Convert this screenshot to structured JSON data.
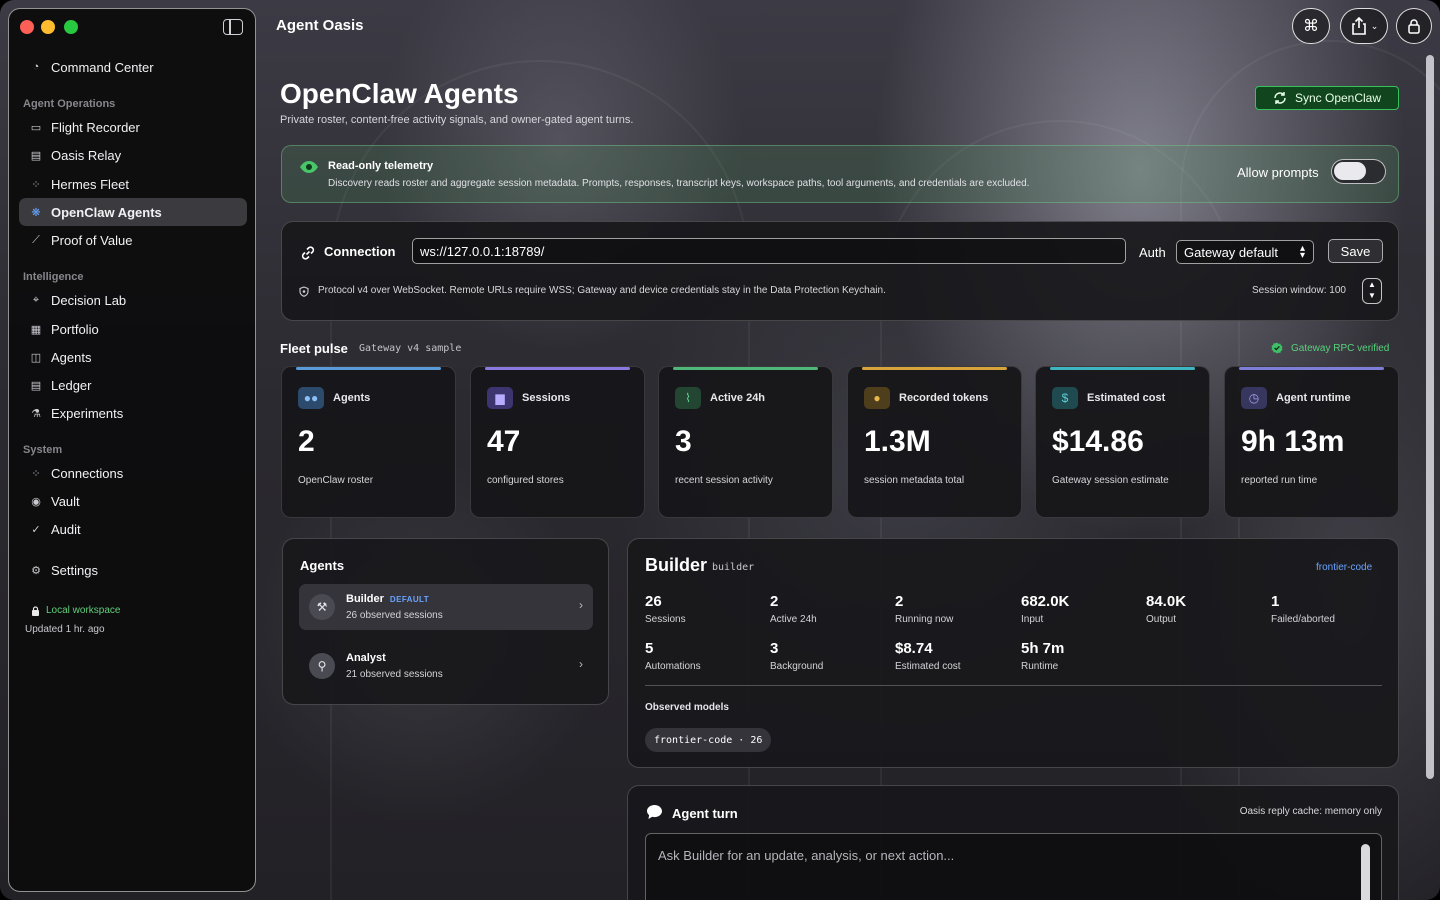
{
  "app": {
    "title": "Agent Oasis"
  },
  "sidebar": {
    "top_item": {
      "label": "Command Center",
      "icon": "gauge-icon"
    },
    "sections": [
      {
        "label": "Agent Operations"
      },
      {
        "label": "Intelligence"
      },
      {
        "label": "System"
      }
    ],
    "items": [
      {
        "label": "Flight Recorder",
        "icon": "recorder-icon"
      },
      {
        "label": "Oasis Relay",
        "icon": "relay-icon"
      },
      {
        "label": "Hermes Fleet",
        "icon": "fleet-icon"
      },
      {
        "label": "OpenClaw Agents",
        "icon": "paw-icon",
        "active": true
      },
      {
        "label": "Proof of Value",
        "icon": "chart-icon"
      },
      {
        "label": "Decision Lab",
        "icon": "decision-icon"
      },
      {
        "label": "Portfolio",
        "icon": "grid-icon"
      },
      {
        "label": "Agents",
        "icon": "chip-icon"
      },
      {
        "label": "Ledger",
        "icon": "ledger-icon"
      },
      {
        "label": "Experiments",
        "icon": "flask-icon"
      },
      {
        "label": "Connections",
        "icon": "connections-icon"
      },
      {
        "label": "Vault",
        "icon": "vault-icon"
      },
      {
        "label": "Audit",
        "icon": "check-icon"
      }
    ],
    "settings": {
      "label": "Settings",
      "icon": "gear-icon"
    },
    "footer": {
      "workspace": "Local workspace",
      "updated": "Updated 1 hr. ago"
    }
  },
  "header": {
    "title": "OpenClaw Agents",
    "subtitle": "Private roster, content-free activity signals, and owner-gated agent turns.",
    "sync_label": "Sync OpenClaw"
  },
  "telemetry": {
    "title": "Read-only telemetry",
    "description": "Discovery reads roster and aggregate session metadata. Prompts, responses, transcript keys, workspace paths, tool arguments, and credentials are excluded.",
    "allow_label": "Allow prompts",
    "allow_enabled": false
  },
  "connection": {
    "label": "Connection",
    "url": "ws://127.0.0.1:18789/",
    "auth_label": "Auth",
    "auth_value": "Gateway default",
    "save_label": "Save",
    "note": "Protocol v4 over WebSocket. Remote URLs require WSS; Gateway and device credentials stay in the Data Protection Keychain.",
    "session_window": "Session window: 100"
  },
  "fleet": {
    "title": "Fleet pulse",
    "tag": "Gateway v4 sample",
    "verified": "Gateway RPC verified",
    "metrics": [
      {
        "label": "Agents",
        "value": "2",
        "sub": "OpenClaw roster",
        "color": "#5a9ad8",
        "icon": "people-icon"
      },
      {
        "label": "Sessions",
        "value": "47",
        "sub": "configured stores",
        "color": "#8a7ae0",
        "icon": "chat-icon"
      },
      {
        "label": "Active 24h",
        "value": "3",
        "sub": "recent session activity",
        "color": "#4fb878",
        "icon": "pulse-icon"
      },
      {
        "label": "Recorded tokens",
        "value": "1.3M",
        "sub": "session metadata total",
        "color": "#d6a43a",
        "icon": "coin-icon"
      },
      {
        "label": "Estimated cost",
        "value": "$14.86",
        "sub": "Gateway session estimate",
        "color": "#3eb5c0",
        "icon": "dollar-icon"
      },
      {
        "label": "Agent runtime",
        "value": "9h 13m",
        "sub": "reported run time",
        "color": "#7e7ed8",
        "icon": "timer-icon"
      }
    ]
  },
  "agents": {
    "title": "Agents",
    "list": [
      {
        "name": "Builder",
        "badge": "DEFAULT",
        "sub": "26 observed sessions",
        "icon": "hammer-icon",
        "selected": true
      },
      {
        "name": "Analyst",
        "badge": "",
        "sub": "21 observed sessions",
        "icon": "magnifier-icon",
        "selected": false
      }
    ]
  },
  "builder": {
    "name": "Builder",
    "id": "builder",
    "model_link": "frontier-code",
    "stats": [
      {
        "value": "26",
        "label": "Sessions"
      },
      {
        "value": "2",
        "label": "Active 24h"
      },
      {
        "value": "2",
        "label": "Running now"
      },
      {
        "value": "682.0K",
        "label": "Input"
      },
      {
        "value": "84.0K",
        "label": "Output"
      },
      {
        "value": "1",
        "label": "Failed/aborted"
      },
      {
        "value": "5",
        "label": "Automations"
      },
      {
        "value": "3",
        "label": "Background"
      },
      {
        "value": "$8.74",
        "label": "Estimated cost"
      },
      {
        "value": "5h 7m",
        "label": "Runtime"
      }
    ],
    "models_label": "Observed models",
    "models": [
      {
        "name": "frontier-code",
        "count": "26",
        "display": "frontier-code · 26"
      }
    ]
  },
  "turn": {
    "title": "Agent turn",
    "cache": "Oasis reply cache: memory only",
    "placeholder": "Ask Builder for an update, analysis, or next action..."
  }
}
